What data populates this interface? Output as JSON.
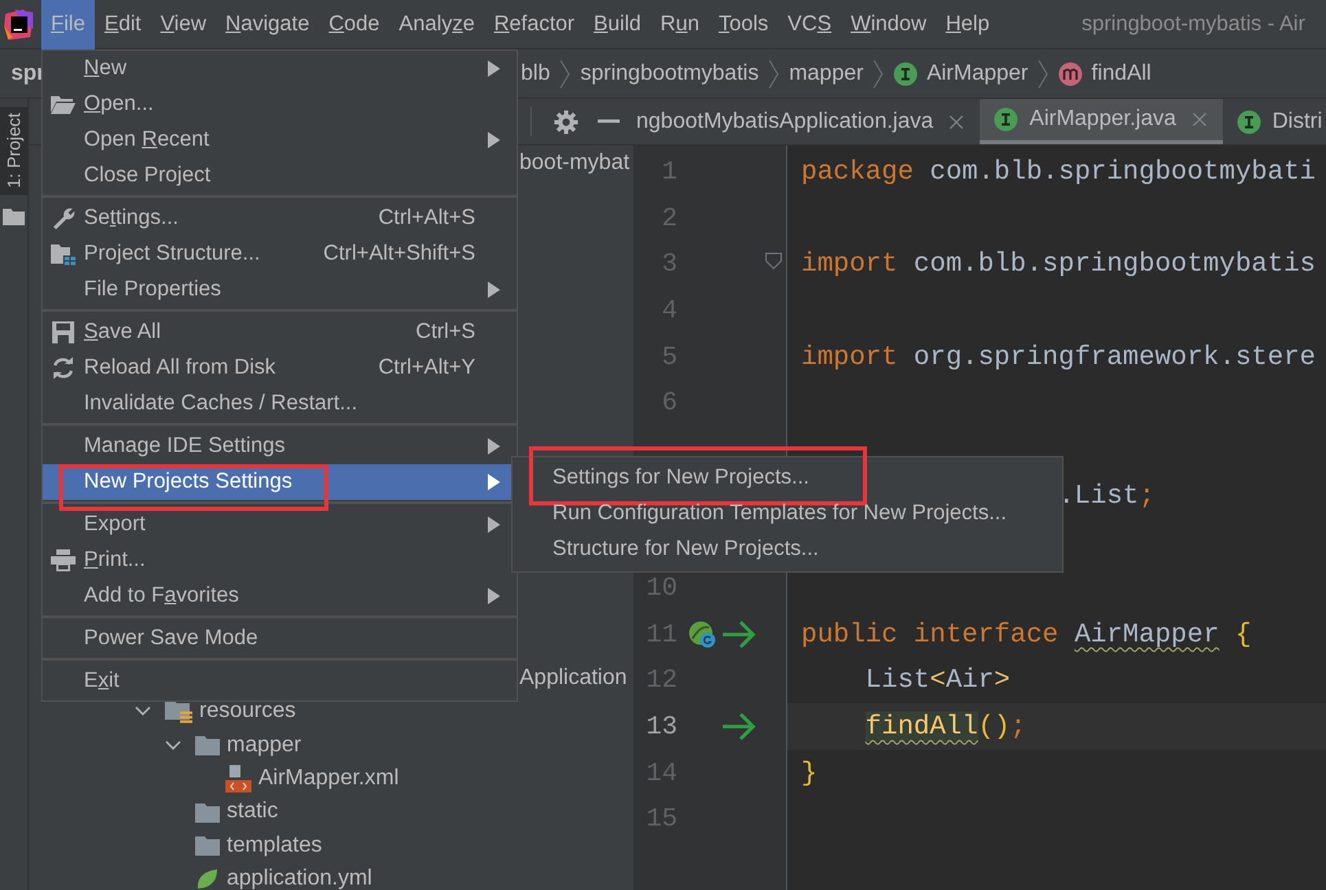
{
  "menubar": {
    "items": [
      {
        "key": "F",
        "post": "ile",
        "selected": true
      },
      {
        "key": "E",
        "post": "dit",
        "selected": false
      },
      {
        "key": "V",
        "post": "iew",
        "selected": false
      },
      {
        "key": "N",
        "post": "avigate",
        "selected": false
      },
      {
        "key": "C",
        "post": "ode",
        "selected": false
      },
      {
        "pre": "Analy",
        "key": "z",
        "post": "e",
        "selected": false
      },
      {
        "key": "R",
        "post": "efactor",
        "selected": false
      },
      {
        "key": "B",
        "post": "uild",
        "selected": false
      },
      {
        "pre": "R",
        "key": "u",
        "post": "n",
        "selected": false
      },
      {
        "key": "T",
        "post": "ools",
        "selected": false
      },
      {
        "pre": "VC",
        "key": "S",
        "selected": false
      },
      {
        "key": "W",
        "post": "indow",
        "selected": false
      },
      {
        "key": "H",
        "post": "elp",
        "selected": false
      }
    ],
    "title": "springboot-mybatis - Air"
  },
  "navbar": {
    "first_crumb": "spr",
    "crumbs": [
      {
        "label": "blb",
        "kind": "package"
      },
      {
        "label": "springbootmybatis",
        "kind": "package"
      },
      {
        "label": "mapper",
        "kind": "package"
      },
      {
        "label": "AirMapper",
        "kind": "interface"
      },
      {
        "label": "findAll",
        "kind": "method"
      }
    ]
  },
  "tool_stripe": {
    "tab": "1: Project",
    "selected": true
  },
  "project": {
    "top_fragment": "boot-mybat",
    "mid_fragment": "Application",
    "tree": [
      {
        "label": "resources",
        "kind": "resources",
        "expanded": true,
        "children": [
          {
            "label": "mapper",
            "kind": "folder",
            "expanded": true,
            "children": [
              {
                "label": "AirMapper.xml",
                "kind": "xml"
              }
            ]
          },
          {
            "label": "static",
            "kind": "folder"
          },
          {
            "label": "templates",
            "kind": "folder"
          },
          {
            "label": "application.yml",
            "kind": "yml"
          }
        ]
      }
    ]
  },
  "tabs": [
    {
      "label": "ngbootMybatisApplication.java",
      "kind": "file",
      "closable": true,
      "selected": false
    },
    {
      "label": "AirMapper.java",
      "kind": "interface",
      "closable": true,
      "selected": true
    },
    {
      "label": "Distri",
      "kind": "interface",
      "closable": false,
      "selected": false
    }
  ],
  "editor": {
    "lines": [
      {
        "number": "1",
        "current": false,
        "fold": false,
        "tokens": [
          {
            "kind": "keyword",
            "text": "package"
          },
          {
            "kind": "plain",
            "text": " com.blb.springbootmybati"
          }
        ]
      },
      {
        "number": "2",
        "current": false,
        "fold": false
      },
      {
        "number": "3",
        "current": false,
        "fold": true,
        "tokens": [
          {
            "kind": "keyword",
            "text": "import"
          },
          {
            "kind": "plain",
            "text": " com.blb.springbootmybatis"
          }
        ]
      },
      {
        "number": "4",
        "current": false,
        "fold": false
      },
      {
        "number": "5",
        "current": false,
        "fold": false,
        "tokens": [
          {
            "kind": "keyword",
            "text": "import"
          },
          {
            "kind": "plain",
            "text": " org.springframework.stere"
          }
        ]
      },
      {
        "number": "6",
        "current": false,
        "fold": false
      },
      {
        "kind": "covered"
      },
      {
        "kind": "covered",
        "tokens": [
          {
            "kind": "plain",
            "text": ".List"
          },
          {
            "kind": "punct",
            "text": ";"
          }
        ]
      },
      {
        "kind": "covered"
      },
      {
        "number": "10",
        "current": false,
        "fold": false
      },
      {
        "number": "11",
        "current": false,
        "fold": false,
        "gutter": [
          {
            "kind": "bean"
          },
          {
            "kind": "implemented"
          }
        ],
        "tokens": [
          {
            "kind": "keyword",
            "text": "public"
          },
          {
            "kind": "keyword",
            "text": " interface "
          },
          {
            "kind": "plain",
            "text": "AirMapper",
            "warning": true
          },
          {
            "kind": "brace",
            "text": " {"
          }
        ]
      },
      {
        "number": "12",
        "current": false,
        "fold": false,
        "indented": true,
        "tokens": [
          {
            "kind": "plain",
            "text": "List"
          },
          {
            "kind": "angle",
            "text": "<"
          },
          {
            "kind": "plain",
            "text": "Air"
          },
          {
            "kind": "angle",
            "text": ">"
          }
        ]
      },
      {
        "number": "13",
        "current": true,
        "fold": false,
        "gutter": [
          {
            "kind": "implemented"
          }
        ],
        "indented": true,
        "tokens": [
          {
            "kind": "method",
            "text": "findAll",
            "warning": true
          },
          {
            "kind": "brace",
            "text": "()"
          },
          {
            "kind": "punct",
            "text": ";"
          }
        ]
      },
      {
        "number": "14",
        "current": false,
        "fold": false,
        "tokens": [
          {
            "kind": "brace",
            "text": "}"
          }
        ]
      },
      {
        "number": "15",
        "current": false,
        "fold": false
      }
    ]
  },
  "file_menu": {
    "groups": [
      {
        "items": [
          {
            "key": "N",
            "post": "ew",
            "submenu": true,
            "selected": false,
            "annotated": false
          },
          {
            "key": "O",
            "post": "pen...",
            "kind": "open",
            "submenu": false,
            "selected": false,
            "annotated": false
          },
          {
            "pre": "Open ",
            "key": "R",
            "post": "ecent",
            "submenu": true,
            "selected": false,
            "annotated": false
          },
          {
            "label": "Close Project",
            "submenu": false,
            "selected": false,
            "annotated": false
          }
        ]
      },
      {
        "items": [
          {
            "pre": "Se",
            "key": "t",
            "post": "tings...",
            "kind": "settings",
            "shortcut": "Ctrl+Alt+S",
            "submenu": false,
            "selected": false,
            "annotated": false
          },
          {
            "label": "Project Structure...",
            "kind": "structure",
            "shortcut": "Ctrl+Alt+Shift+S",
            "submenu": false,
            "selected": false,
            "annotated": false
          },
          {
            "label": "File Properties",
            "submenu": true,
            "selected": false,
            "annotated": false
          }
        ]
      },
      {
        "items": [
          {
            "key": "S",
            "post": "ave All",
            "kind": "save",
            "shortcut": "Ctrl+S",
            "submenu": false,
            "selected": false,
            "annotated": false
          },
          {
            "label": "Reload All from Disk",
            "kind": "reload",
            "shortcut": "Ctrl+Alt+Y",
            "submenu": false,
            "selected": false,
            "annotated": false
          },
          {
            "label": "Invalidate Caches / Restart...",
            "submenu": false,
            "selected": false,
            "annotated": false
          }
        ]
      },
      {
        "items": [
          {
            "label": "Manage IDE Settings",
            "submenu": true,
            "selected": false,
            "annotated": false
          },
          {
            "label": "New Projects Settings",
            "submenu": true,
            "selected": true,
            "annotated": true
          }
        ]
      },
      {
        "items": [
          {
            "label": "Export",
            "submenu": true,
            "selected": false,
            "annotated": false
          },
          {
            "key": "P",
            "post": "rint...",
            "kind": "print",
            "submenu": false,
            "selected": false,
            "annotated": false
          },
          {
            "pre": "Add to F",
            "key": "a",
            "post": "vorites",
            "submenu": true,
            "selected": false,
            "annotated": false
          }
        ]
      },
      {
        "items": [
          {
            "label": "Power Save Mode",
            "submenu": false,
            "selected": false,
            "annotated": false
          }
        ]
      },
      {
        "items": [
          {
            "pre": "E",
            "key": "x",
            "post": "it",
            "submenu": false,
            "selected": false,
            "annotated": false
          }
        ]
      }
    ]
  },
  "submenu": {
    "items": [
      {
        "label": "Settings for New Projects...",
        "annotated": true
      },
      {
        "label": "Run Configuration Templates for New Projects...",
        "annotated": false
      },
      {
        "label": "Structure for New Projects...",
        "annotated": false
      }
    ]
  }
}
